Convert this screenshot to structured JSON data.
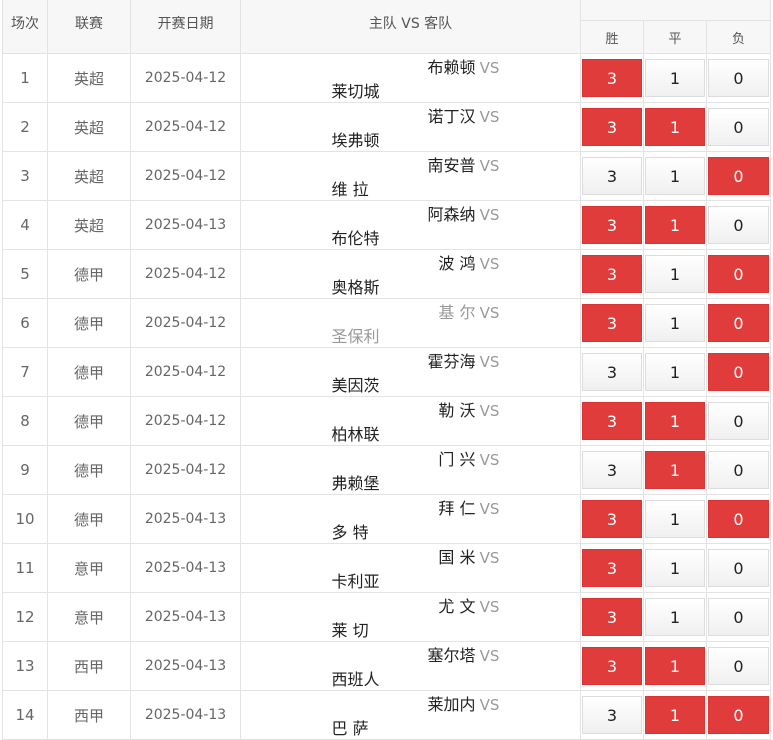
{
  "headers": {
    "idx": "场次",
    "league": "联赛",
    "date": "开赛日期",
    "match": "主队 VS 客队",
    "win": "胜",
    "draw": "平",
    "lose": "负"
  },
  "options": [
    "3",
    "1",
    "0"
  ],
  "vs_label": "VS",
  "colors": {
    "selected": "#e13c3c"
  },
  "rows": [
    {
      "idx": "1",
      "league": "英超",
      "date": "2025-04-12",
      "home": "布赖顿",
      "away": "莱切城",
      "sel": [
        true,
        false,
        false
      ]
    },
    {
      "idx": "2",
      "league": "英超",
      "date": "2025-04-12",
      "home": "诺丁汉",
      "away": "埃弗顿",
      "sel": [
        true,
        true,
        false
      ]
    },
    {
      "idx": "3",
      "league": "英超",
      "date": "2025-04-12",
      "home": "南安普",
      "away": "维 拉",
      "sel": [
        false,
        false,
        true
      ]
    },
    {
      "idx": "4",
      "league": "英超",
      "date": "2025-04-13",
      "home": "阿森纳",
      "away": "布伦特",
      "sel": [
        true,
        true,
        false
      ]
    },
    {
      "idx": "5",
      "league": "德甲",
      "date": "2025-04-12",
      "home": "波 鸿",
      "away": "奥格斯",
      "sel": [
        true,
        false,
        true
      ]
    },
    {
      "idx": "6",
      "league": "德甲",
      "date": "2025-04-12",
      "home": "基 尔",
      "away": "圣保利",
      "sel": [
        true,
        false,
        true
      ],
      "muted": true
    },
    {
      "idx": "7",
      "league": "德甲",
      "date": "2025-04-12",
      "home": "霍芬海",
      "away": "美因茨",
      "sel": [
        false,
        false,
        true
      ]
    },
    {
      "idx": "8",
      "league": "德甲",
      "date": "2025-04-12",
      "home": "勒 沃",
      "away": "柏林联",
      "sel": [
        true,
        true,
        false
      ]
    },
    {
      "idx": "9",
      "league": "德甲",
      "date": "2025-04-12",
      "home": "门 兴",
      "away": "弗赖堡",
      "sel": [
        false,
        true,
        false
      ]
    },
    {
      "idx": "10",
      "league": "德甲",
      "date": "2025-04-13",
      "home": "拜 仁",
      "away": "多 特",
      "sel": [
        true,
        false,
        true
      ]
    },
    {
      "idx": "11",
      "league": "意甲",
      "date": "2025-04-13",
      "home": "国 米",
      "away": "卡利亚",
      "sel": [
        true,
        false,
        false
      ]
    },
    {
      "idx": "12",
      "league": "意甲",
      "date": "2025-04-13",
      "home": "尤 文",
      "away": "莱 切",
      "sel": [
        true,
        false,
        false
      ]
    },
    {
      "idx": "13",
      "league": "西甲",
      "date": "2025-04-13",
      "home": "塞尔塔",
      "away": "西班人",
      "sel": [
        true,
        true,
        false
      ]
    },
    {
      "idx": "14",
      "league": "西甲",
      "date": "2025-04-13",
      "home": "莱加内",
      "away": "巴 萨",
      "sel": [
        false,
        true,
        true
      ]
    }
  ]
}
